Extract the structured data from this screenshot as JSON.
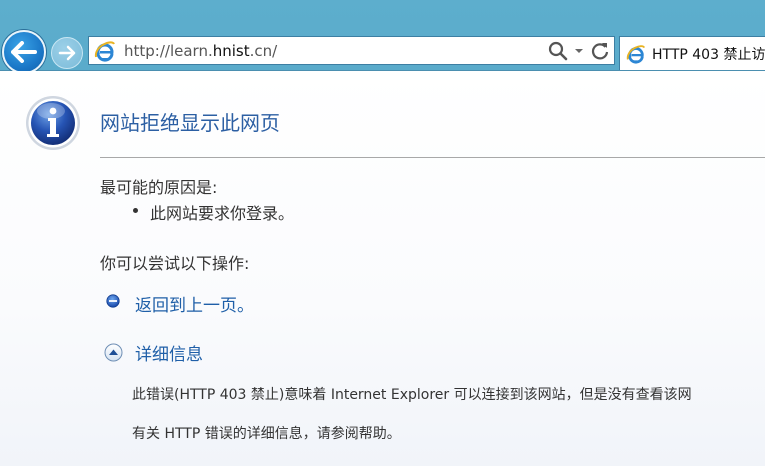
{
  "browser": {
    "address": {
      "url_prefix": "http://learn.",
      "url_domain": "hnist",
      "url_suffix": ".cn/"
    },
    "tab": {
      "title": "HTTP 403 禁止访"
    },
    "icons": {
      "back": "back-arrow-icon",
      "forward": "forward-arrow-icon",
      "search": "search-icon",
      "dropdown": "chevron-down-icon",
      "refresh": "refresh-icon",
      "site": "internet-explorer-icon"
    },
    "colors": {
      "chrome": "#5daecd",
      "back_button": "#1b78c8"
    }
  },
  "page": {
    "heading": "网站拒绝显示此网页",
    "reason_title": "最可能的原因是:",
    "reasons": [
      "此网站要求你登录。"
    ],
    "try_title": "你可以尝试以下操作:",
    "back_link": "返回到上一页。",
    "details_link": "详细信息",
    "detail_lines": [
      "此错误(HTTP 403 禁止)意味着 Internet Explorer 可以连接到该网站，但是没有查看该网",
      "有关 HTTP 错误的详细信息，请参阅帮助。"
    ],
    "icons": {
      "info": "info-icon",
      "bullet": "blue-bullet-icon",
      "expand": "collapse-arrow-icon"
    },
    "colors": {
      "heading": "#2c5fa3",
      "link": "#1f5fa8"
    }
  }
}
